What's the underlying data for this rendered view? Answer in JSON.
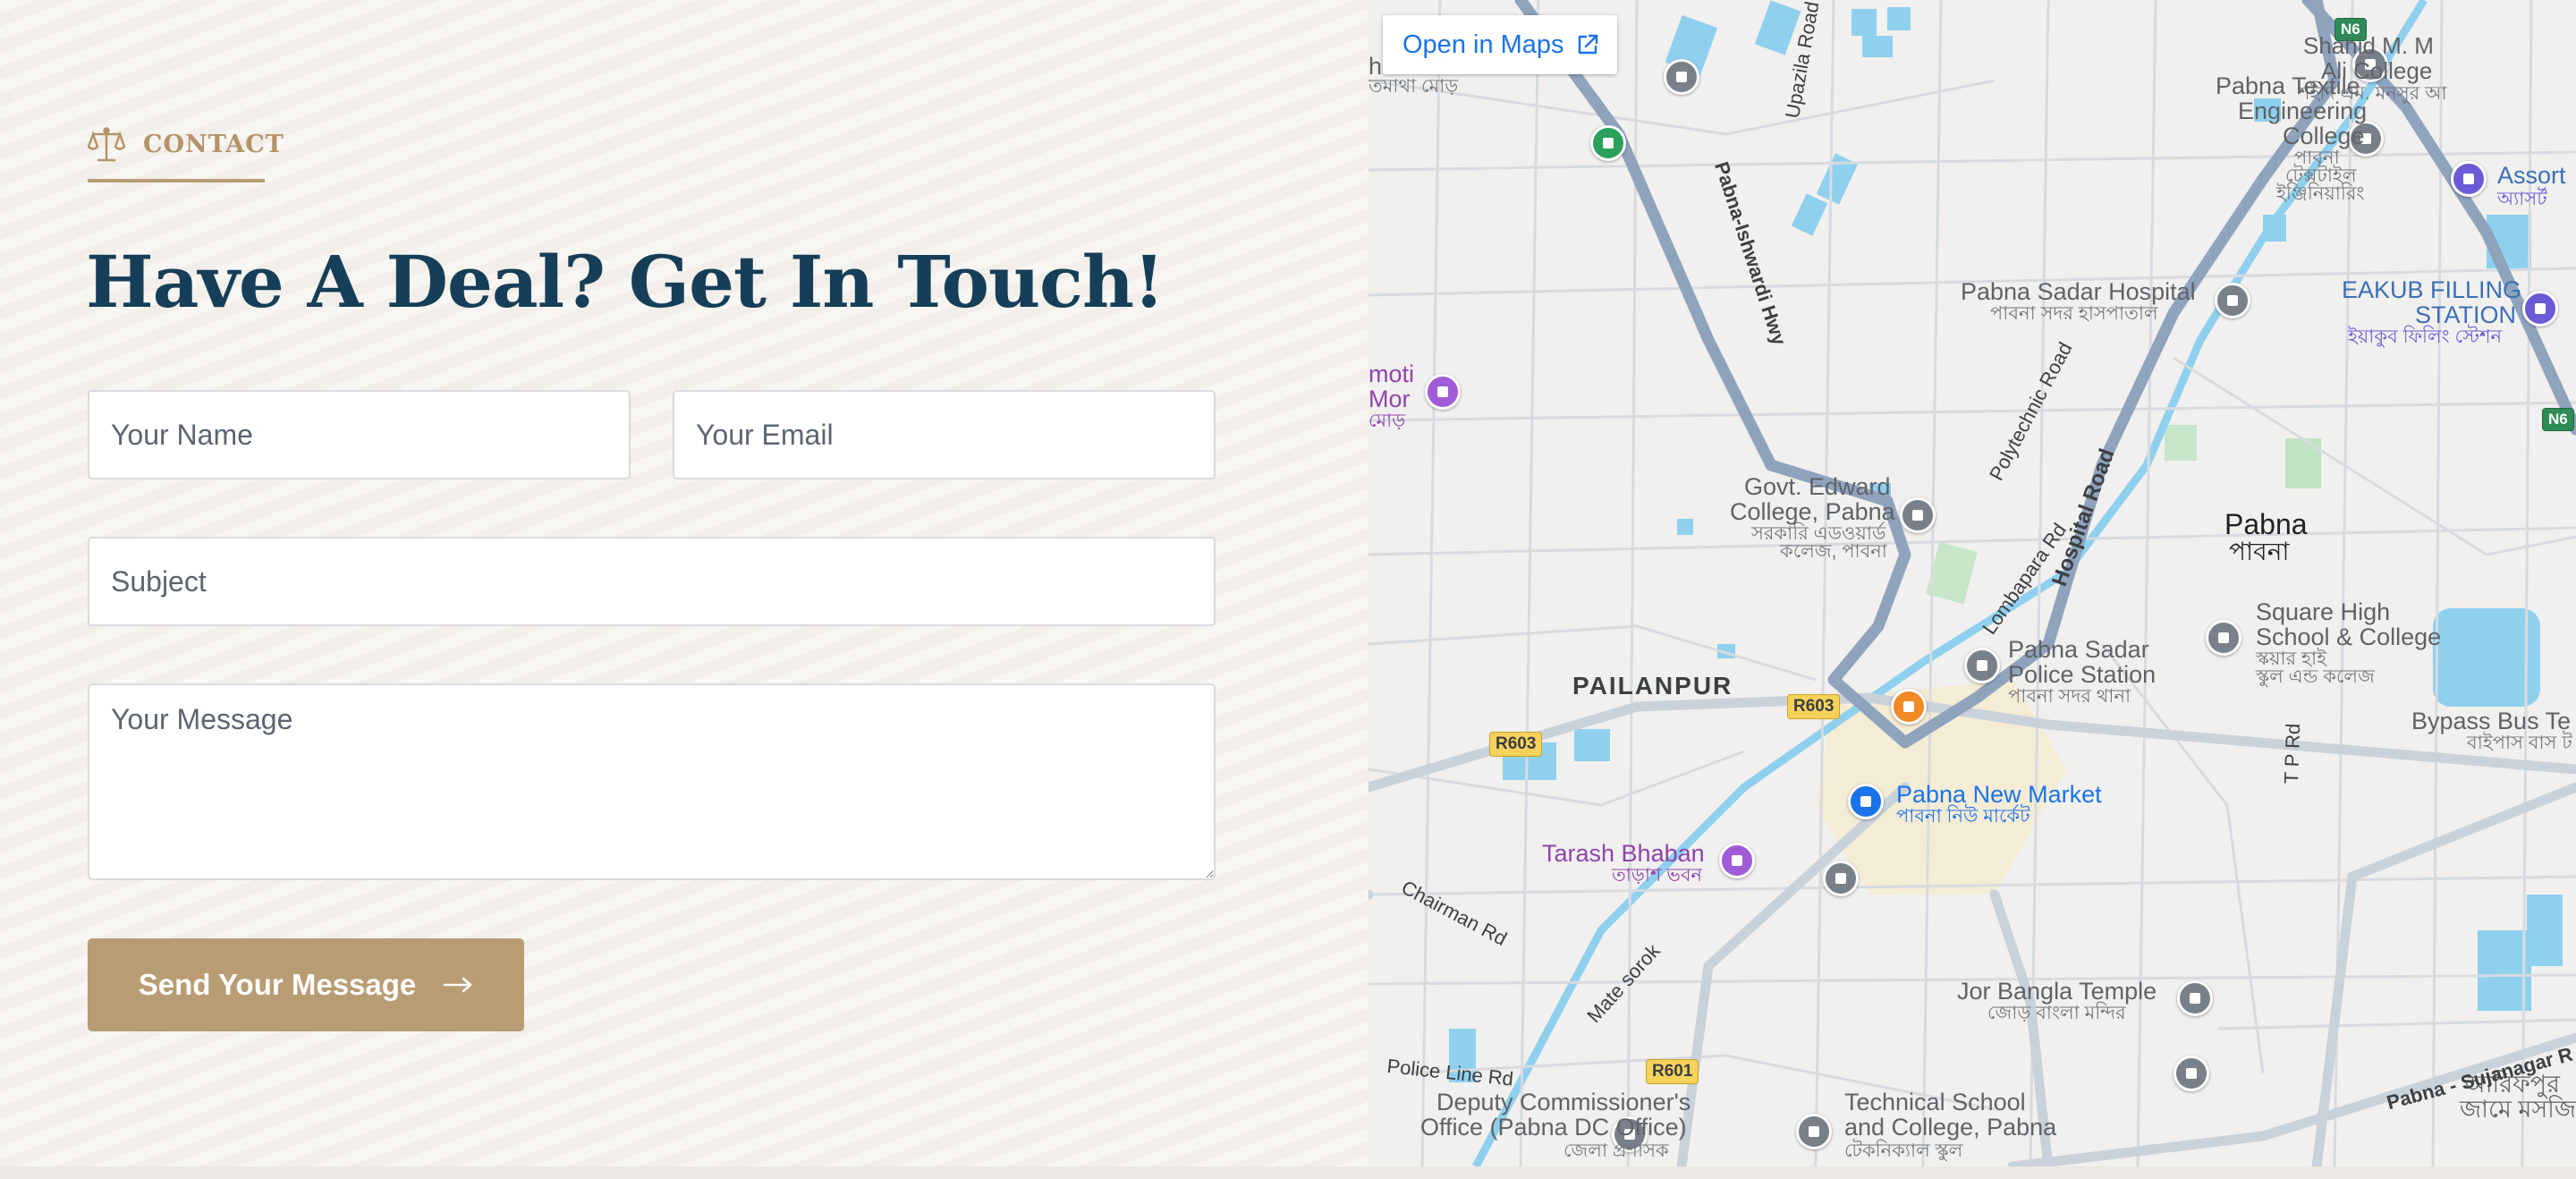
{
  "contact": {
    "eyebrow": "CONTACT",
    "headline": "Have A Deal? Get In Touch!",
    "form": {
      "name_placeholder": "Your Name",
      "email_placeholder": "Your Email",
      "subject_placeholder": "Subject",
      "message_placeholder": "Your Message",
      "submit_label": "Send Your Message"
    },
    "colors": {
      "accent": "#b89c73",
      "headline": "#163e58",
      "background": "#f5f1ec"
    }
  },
  "map": {
    "open_in_maps": "Open in Maps",
    "labels": {
      "shahid_1": "Shahid M. M",
      "shahid_2": "Ali College",
      "shahid_bn": "শহীদ এম. মনসুর আ",
      "textile_1": "Pabna Textile",
      "textile_2": "Engineering",
      "textile_3": "College",
      "textile_bn1": "পাবনা",
      "textile_bn2": "টেক্সটাইল",
      "textile_bn3": "ইঞ্জিনিয়ারিং",
      "assort": "Assort",
      "assort_bn": "অ্যাসর্ট",
      "sadar_hospital": "Pabna Sadar Hospital",
      "sadar_hospital_bn": "পাবনা সদর হাসপাতাল",
      "eakub_1": "EAKUB FILLING",
      "eakub_2": "STATION",
      "eakub_bn": "ইয়াকুব ফিলিং স্টেশন",
      "govt_1": "Govt. Edward",
      "govt_2": "College, Pabna",
      "govt_bn1": "সরকারি এডওয়ার্ড",
      "govt_bn2": "কলেজ, পাবনা",
      "town": "Pabna",
      "town_bn": "পাবনা",
      "square_1": "Square High",
      "square_2": "School & College",
      "square_bn1": "স্কয়ার হাই",
      "square_bn2": "স্কুল এন্ড কলেজ",
      "police_1": "Pabna Sadar",
      "police_2": "Police Station",
      "police_bn": "পাবনা সদর থানা",
      "pailanpur": "PAILANPUR",
      "bypass": "Bypass Bus Te",
      "bypass_bn": "বাইপাস বাস ট",
      "new_market": "Pabna New Market",
      "new_market_bn": "পাবনা নিউ মার্কেট",
      "tarash": "Tarash Bhaban",
      "tarash_bn": "তাড়াশ ভবন",
      "jor_bangla": "Jor Bangla Temple",
      "jor_bangla_bn": "জোড় বাংলা মন্দির",
      "dc_1": "Deputy Commissioner's",
      "dc_2": "Office (Pabna DC Office)",
      "dc_bn": "জেলা প্রশাসক",
      "tech_1": "Technical School",
      "tech_2": "and College, Pabna",
      "tech_bn": "টেকনিক্যাল স্কুল",
      "amoti_1": "moti",
      "amoti_2": "Mor",
      "amoti_bn": "মোড়",
      "top_left_1": "h",
      "top_left_bn": "তমাথা মোড়",
      "arifpur_1": "আরিফপুর",
      "arifpur_2": "জামে মসজি"
    },
    "roads": {
      "upazila": "Upazila Road",
      "ishwardi": "Pabna-Ishwardi Hwy",
      "polytechnic": "Polytechnic Road",
      "lombapara": "Lombapara Rd",
      "hospital": "Hospital Road",
      "chairman": "Chairman Rd",
      "mate_sorok": "Mate sorok",
      "police_line": "Police Line Rd",
      "tp_rd": "T P Rd",
      "sujanagar": "Pabna - Sujanagar R"
    },
    "shields": {
      "n6_top": "N6",
      "n6_right": "N6",
      "r603_a": "R603",
      "r603_b": "R603",
      "r601": "R601"
    }
  }
}
